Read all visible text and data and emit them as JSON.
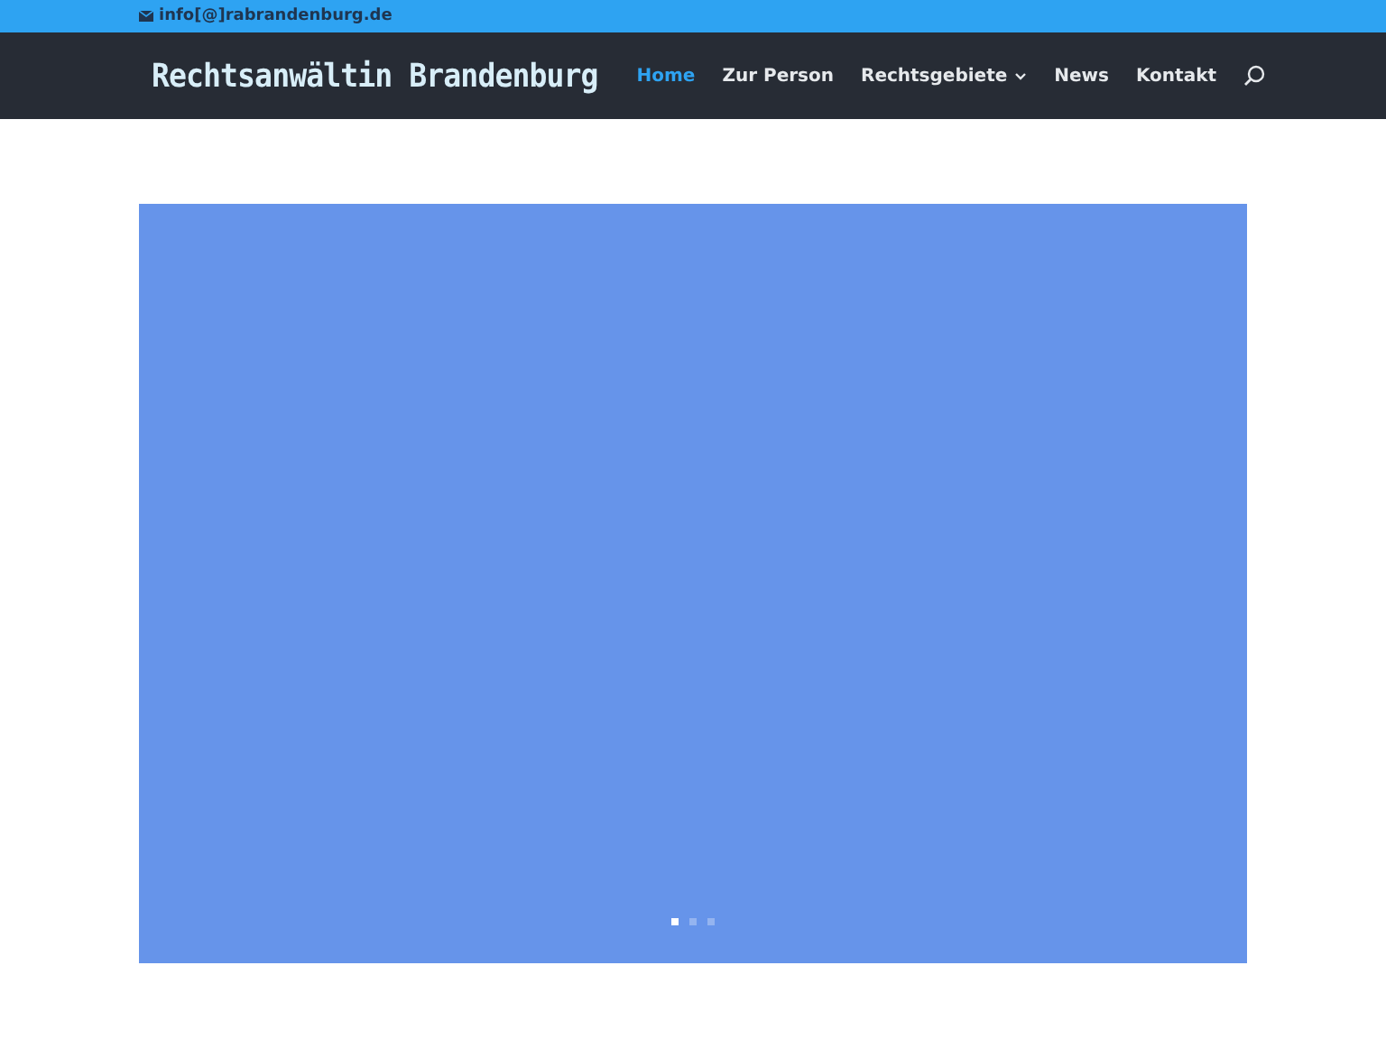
{
  "top_bar": {
    "email": "info[@]rabrandenburg.de"
  },
  "header": {
    "logo": "Rechtsanwältin Brandenburg",
    "nav": [
      {
        "label": "Home",
        "selected": true,
        "has_submenu": false
      },
      {
        "label": "Zur Person",
        "selected": false,
        "has_submenu": false
      },
      {
        "label": "Rechtsgebiete",
        "selected": false,
        "has_submenu": true
      },
      {
        "label": "News",
        "selected": false,
        "has_submenu": false
      },
      {
        "label": "Kontakt",
        "selected": false,
        "has_submenu": false
      }
    ]
  },
  "slider": {
    "dots": [
      {
        "selected": true
      },
      {
        "selected": false
      },
      {
        "selected": false
      }
    ]
  }
}
